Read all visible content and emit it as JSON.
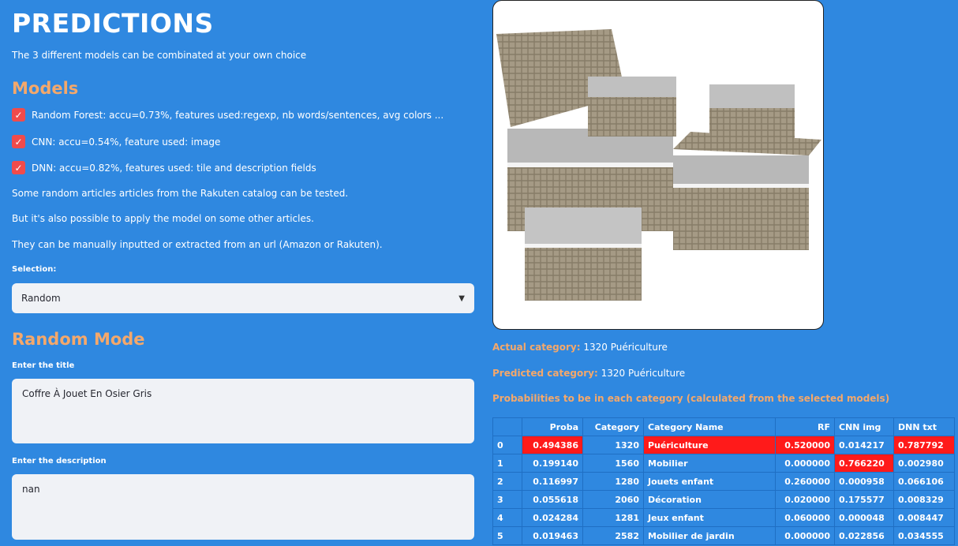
{
  "header": {
    "title": "PREDICTIONS",
    "subtitle": "The 3 different models can be combinated at your own choice"
  },
  "models": {
    "heading": "Models",
    "items": [
      {
        "label": "Random Forest: accu=0.73%, features used:regexp, nb words/sentences, avg colors ...",
        "checked": true
      },
      {
        "label": "CNN: accu=0.54%, feature used: image",
        "checked": true
      },
      {
        "label": "DNN: accu=0.82%, features used: tile and description fields",
        "checked": true
      }
    ]
  },
  "info_lines": [
    "Some random articles articles from the Rakuten catalog can be tested.",
    "But it's also possible to apply the model on some other articles.",
    "They can be manually inputted or extracted from an url (Amazon or Rakuten)."
  ],
  "selection": {
    "label": "Selection:",
    "value": "Random"
  },
  "random_mode": {
    "heading": "Random Mode",
    "title_label": "Enter the title",
    "title_value": "Coffre À Jouet En Osier Gris",
    "description_label": "Enter the description",
    "description_value": "nan"
  },
  "result": {
    "actual_label": "Actual category:",
    "actual_value": "1320 Puériculture",
    "predicted_label": "Predicted category:",
    "predicted_value": "1320 Puériculture",
    "prob_title": "Probabilities to be in each category (calculated from the selected models)"
  },
  "table": {
    "headers": [
      "",
      "Proba",
      "Category",
      "Category Name",
      "RF",
      "CNN img",
      "DNN txt"
    ],
    "rows": [
      [
        "0",
        "0.494386",
        "1320",
        "Puériculture",
        "0.520000",
        "0.014217",
        "0.787792"
      ],
      [
        "1",
        "0.199140",
        "1560",
        "Mobilier",
        "0.000000",
        "0.766220",
        "0.002980"
      ],
      [
        "2",
        "0.116997",
        "1280",
        "Jouets enfant",
        "0.260000",
        "0.000958",
        "0.066106"
      ],
      [
        "3",
        "0.055618",
        "2060",
        "Décoration",
        "0.020000",
        "0.175577",
        "0.008329"
      ],
      [
        "4",
        "0.024284",
        "1281",
        "Jeux enfant",
        "0.060000",
        "0.000048",
        "0.008447"
      ],
      [
        "5",
        "0.019463",
        "2582",
        "Mobilier de jardin",
        "0.000000",
        "0.022856",
        "0.034555"
      ]
    ]
  },
  "colors": {
    "background": "#2f88e0",
    "accent": "#f4a86b",
    "highlight": "#ff1a1a",
    "checkbox": "#f14b4b"
  },
  "icons": {
    "checkbox": "check-icon",
    "select": "chevron-down-icon",
    "product": "wicker-baskets-image"
  }
}
